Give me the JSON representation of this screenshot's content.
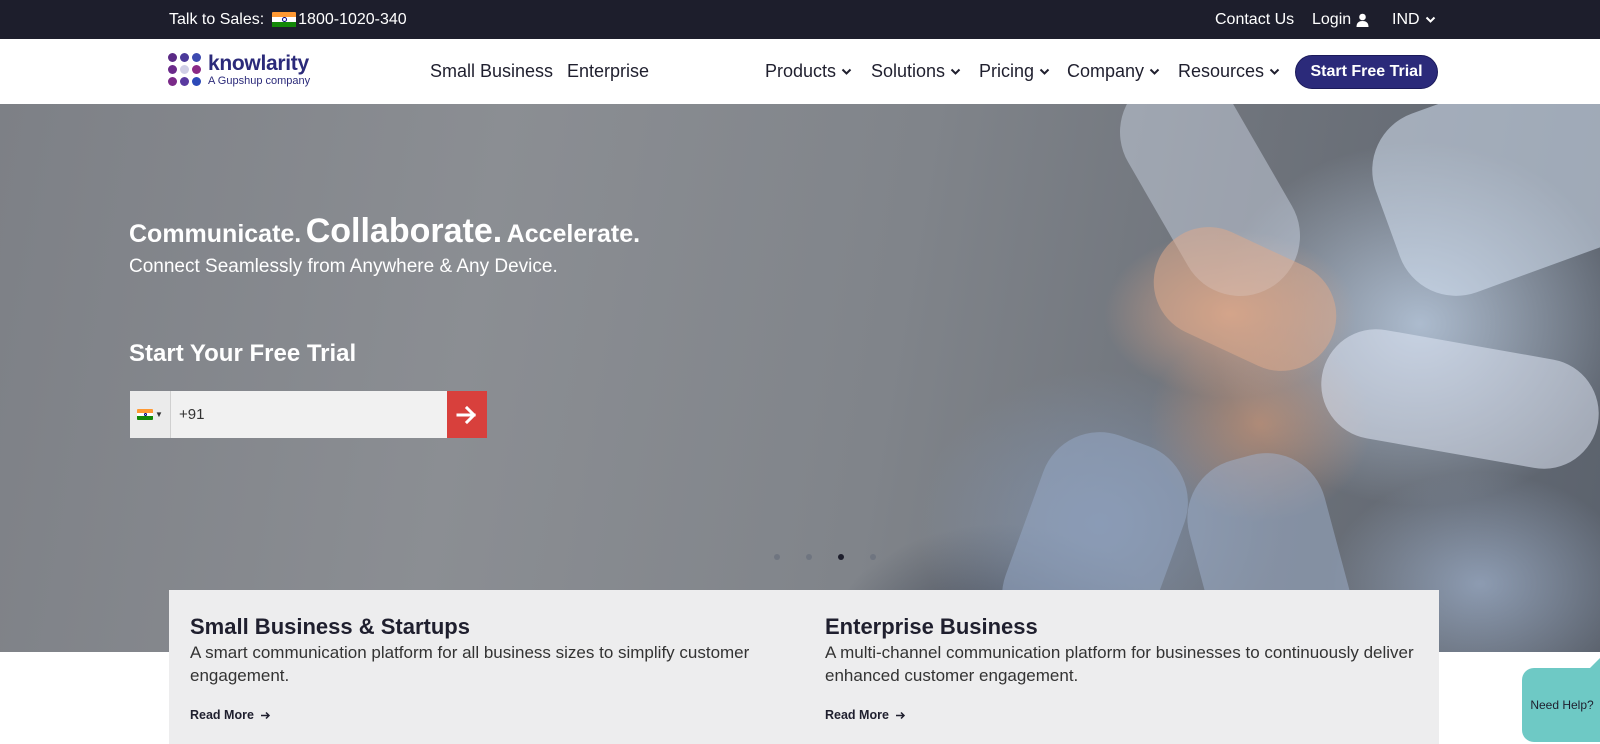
{
  "topbar": {
    "sales_label": "Talk to Sales:",
    "phone": "1800-1020-340",
    "contact": "Contact Us",
    "login": "Login",
    "region": "IND"
  },
  "nav": {
    "logo_brand": "knowlarity",
    "logo_sub": "A Gupshup company",
    "small_business": "Small Business",
    "enterprise": "Enterprise",
    "products": "Products",
    "solutions": "Solutions",
    "pricing": "Pricing",
    "company": "Company",
    "resources": "Resources",
    "cta": "Start Free Trial"
  },
  "hero": {
    "word1": "Communicate.",
    "word2": "Collaborate.",
    "word3": "Accelerate.",
    "subtitle": "Connect Seamlessly from Anywhere & Any Device.",
    "trial_title": "Start Your Free Trial",
    "phone_value": "+91",
    "carousel_count": 4,
    "carousel_active": 3
  },
  "cards": [
    {
      "title": "Small Business & Startups",
      "text": "A smart communication platform for all business sizes to simplify customer engagement.",
      "more": "Read More"
    },
    {
      "title": "Enterprise Business",
      "text": "A multi-channel communication platform for businesses to continuously deliver enhanced customer engagement.",
      "more": "Read More"
    }
  ],
  "help": "Need Help?",
  "colors": {
    "topbar": "#1d1e2c",
    "brand": "#2b2a7a",
    "cta": "#2b2a7a",
    "go_button": "#d8403c",
    "help": "#6ec9c5"
  },
  "icons": {
    "login": "user-icon",
    "dropdown": "chevron-down-icon",
    "go": "arrow-right-icon",
    "read_more": "arrow-right-icon"
  }
}
